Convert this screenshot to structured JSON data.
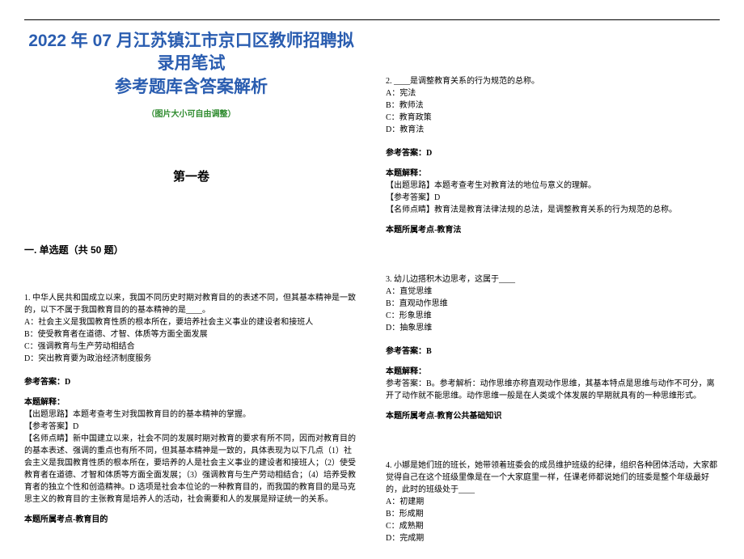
{
  "header": {
    "title_line1": "2022 年 07 月江苏镇江市京口区教师招聘拟录用笔试",
    "title_line2": "参考题库含答案解析",
    "subtitle": "（图片大小可自由调整）",
    "volume": "第一卷",
    "section": "一. 单选题（共 50 题）"
  },
  "q1": {
    "stem_a": "1. 中华人民共和国成立以来，我国不同历史时期对教育目的的表述不同，但其基本精神是一致的，以下不属于我国教育目的的基本精神的是____。",
    "opts": {
      "A": "A：社会主义是我国教育性质的根本所在，要培养社会主义事业的建设者和接班人",
      "B": "B：使受教育者在道德、才智、体质等方面全面发展",
      "C": "C：强调教育与生产劳动相结合",
      "D": "D：突出教育要为政治经济制度服务"
    },
    "answer_label": "参考答案：D",
    "explain_label": "本题解释：",
    "explain1": "【出题思路】本题考查考生对我国教育目的的基本精神的掌握。",
    "explain2": "【参考答案】D",
    "explain3": "【名师点睛】新中国建立以来，社会不同的发展时期对教育的要求有所不同，因而对教育目的的基本表述、强调的重点也有所不同，但其基本精神是一致的，具体表现为以下几点（1）社会主义是我国教育性质的根本所在，要培养的人是社会主义事业的建设者和接班人；（2）使受教育者在道德、才智和体质等方面全面发展；（3）强调教育与生产劳动相结合；（4）培养受教育者的独立个性和创造精神。D 选项是社会本位论的一种教育目的，而我国的教育目的是马克思主义的教育目的'主张教育是培养人的活动，社会需要和人的发展是辩证统一的关系。",
    "topic": "本题所属考点-教育目的"
  },
  "q2": {
    "stem": "2. ____是调整教育关系的行为规范的总称。",
    "opts": {
      "A": "A：宪法",
      "B": "B：教师法",
      "C": "C：教育政策",
      "D": "D：教育法"
    },
    "answer_label": "参考答案：D",
    "explain_label": "本题解释：",
    "explain1": "【出题思路】本题考查考生对教育法的地位与意义的理解。",
    "explain2": "【参考答案】D",
    "explain3": "【名师点睛】教育法是教育法律法规的总法，是调整教育关系的行为规范的总称。",
    "topic": "本题所属考点-教育法"
  },
  "q3": {
    "stem": "3. 幼儿边搭积木边思考，这属于____",
    "opts": {
      "A": "A：直觉思维",
      "B": "B：直观动作思维",
      "C": "C：形象思维",
      "D": "D：抽象思维"
    },
    "answer_label": "参考答案：B",
    "explain_label": "本题解释：",
    "explain1": "参考答案：B。参考解析：动作思维亦称直观动作思维，其基本特点是思维与动作不可分，离开了动作就不能思维。动作思维一般是在人类或个体发展的早期就具有的一种思维形式。",
    "topic": "本题所属考点-教育公共基础知识"
  },
  "q4": {
    "stem": "4. 小娜是她们班的班长，她带领着班委会的成员维护班级的纪律，组织各种团体活动，大家都觉得自己在这个班级里像是在一个大家庭里一样，任课老师都说她们的班委是整个年级最好的，此时的班级处于____",
    "opts": {
      "A": "A：初建期",
      "B": "B：形成期",
      "C": "C：成熟期",
      "D": "D：完成期"
    }
  }
}
